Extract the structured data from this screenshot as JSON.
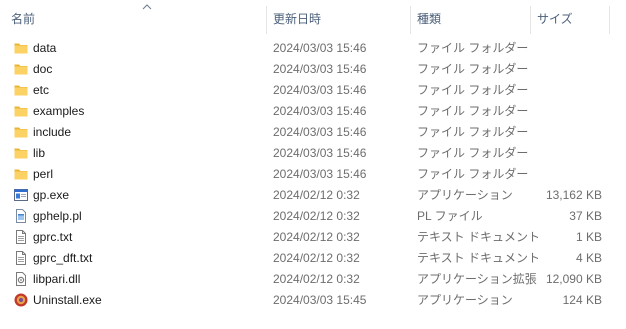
{
  "header": {
    "name": "名前",
    "date": "更新日時",
    "type": "種類",
    "size": "サイズ"
  },
  "files": [
    {
      "name": "data",
      "date": "2024/03/03 15:46",
      "type": "ファイル フォルダー",
      "size": "",
      "icon": "folder-icon"
    },
    {
      "name": "doc",
      "date": "2024/03/03 15:46",
      "type": "ファイル フォルダー",
      "size": "",
      "icon": "folder-icon"
    },
    {
      "name": "etc",
      "date": "2024/03/03 15:46",
      "type": "ファイル フォルダー",
      "size": "",
      "icon": "folder-icon"
    },
    {
      "name": "examples",
      "date": "2024/03/03 15:46",
      "type": "ファイル フォルダー",
      "size": "",
      "icon": "folder-icon"
    },
    {
      "name": "include",
      "date": "2024/03/03 15:46",
      "type": "ファイル フォルダー",
      "size": "",
      "icon": "folder-icon"
    },
    {
      "name": "lib",
      "date": "2024/03/03 15:46",
      "type": "ファイル フォルダー",
      "size": "",
      "icon": "folder-icon"
    },
    {
      "name": "perl",
      "date": "2024/03/03 15:46",
      "type": "ファイル フォルダー",
      "size": "",
      "icon": "folder-icon"
    },
    {
      "name": "gp.exe",
      "date": "2024/02/12 0:32",
      "type": "アプリケーション",
      "size": "13,162 KB",
      "icon": "exe-icon"
    },
    {
      "name": "gphelp.pl",
      "date": "2024/02/12 0:32",
      "type": "PL ファイル",
      "size": "37 KB",
      "icon": "script-file-icon"
    },
    {
      "name": "gprc.txt",
      "date": "2024/02/12 0:32",
      "type": "テキスト ドキュメント",
      "size": "1 KB",
      "icon": "text-file-icon"
    },
    {
      "name": "gprc_dft.txt",
      "date": "2024/02/12 0:32",
      "type": "テキスト ドキュメント",
      "size": "4 KB",
      "icon": "text-file-icon"
    },
    {
      "name": "libpari.dll",
      "date": "2024/02/12 0:32",
      "type": "アプリケーション拡張",
      "size": "12,090 KB",
      "icon": "dll-icon"
    },
    {
      "name": "Uninstall.exe",
      "date": "2024/03/03 15:45",
      "type": "アプリケーション",
      "size": "124 KB",
      "icon": "uninstall-icon"
    }
  ]
}
